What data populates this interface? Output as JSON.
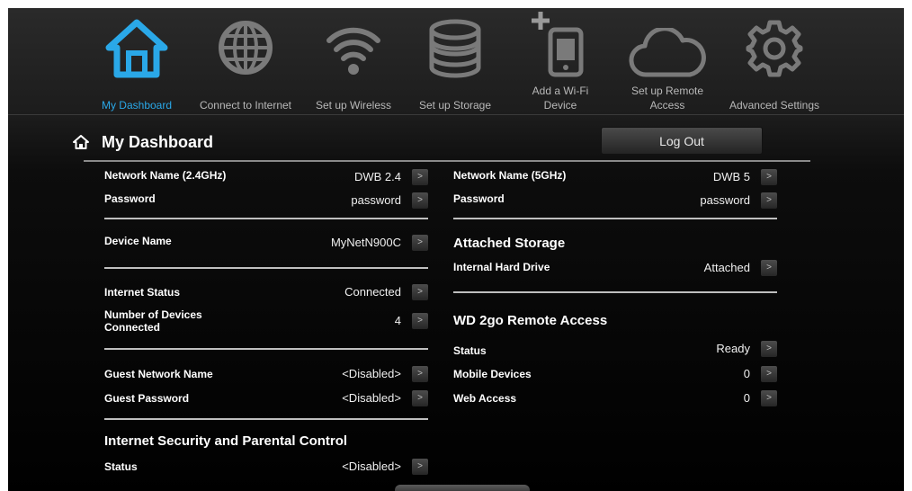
{
  "nav": {
    "items": [
      {
        "label": "My Dashboard",
        "icon": "home-icon"
      },
      {
        "label": "Connect to Internet",
        "icon": "globe-icon"
      },
      {
        "label": "Set up Wireless",
        "icon": "wifi-icon"
      },
      {
        "label": "Set up Storage",
        "icon": "storage-icon"
      },
      {
        "label_line1": "Add a Wi-Fi",
        "label_line2": "Device",
        "icon": "add-device-icon"
      },
      {
        "label_line1": "Set up Remote",
        "label_line2": "Access",
        "icon": "cloud-icon"
      },
      {
        "label": "Advanced Settings",
        "icon": "gear-icon"
      }
    ],
    "active_color": "#2aa8e8"
  },
  "header": {
    "title": "My Dashboard",
    "logout_label": "Log Out"
  },
  "left": {
    "network_name_24": {
      "label": "Network Name (2.4GHz)",
      "value": "DWB 2.4"
    },
    "password_24": {
      "label": "Password",
      "value": "password"
    },
    "device_name": {
      "label": "Device Name",
      "value": "MyNetN900C"
    },
    "internet_status": {
      "label": "Internet Status",
      "value": "Connected"
    },
    "devices_connected": {
      "label_line1": "Number of Devices",
      "label_line2": "Connected",
      "value": "4"
    },
    "guest_network": {
      "label": "Guest Network Name",
      "value": "<Disabled>"
    },
    "guest_password": {
      "label": "Guest Password",
      "value": "<Disabled>"
    },
    "security_title": "Internet Security and Parental Control",
    "security_status": {
      "label": "Status",
      "value": "<Disabled>"
    }
  },
  "right": {
    "network_name_5": {
      "label": "Network Name (5GHz)",
      "value": "DWB 5"
    },
    "password_5": {
      "label": "Password",
      "value": "password"
    },
    "storage_title": "Attached Storage",
    "internal_drive": {
      "label": "Internal Hard Drive",
      "value": "Attached"
    },
    "remote_title": "WD 2go Remote Access",
    "remote_status": {
      "label": "Status",
      "value": "Ready"
    },
    "mobile_devices": {
      "label": "Mobile Devices",
      "value": "0"
    },
    "web_access": {
      "label": "Web Access",
      "value": "0"
    }
  },
  "arrow_glyph": ">"
}
